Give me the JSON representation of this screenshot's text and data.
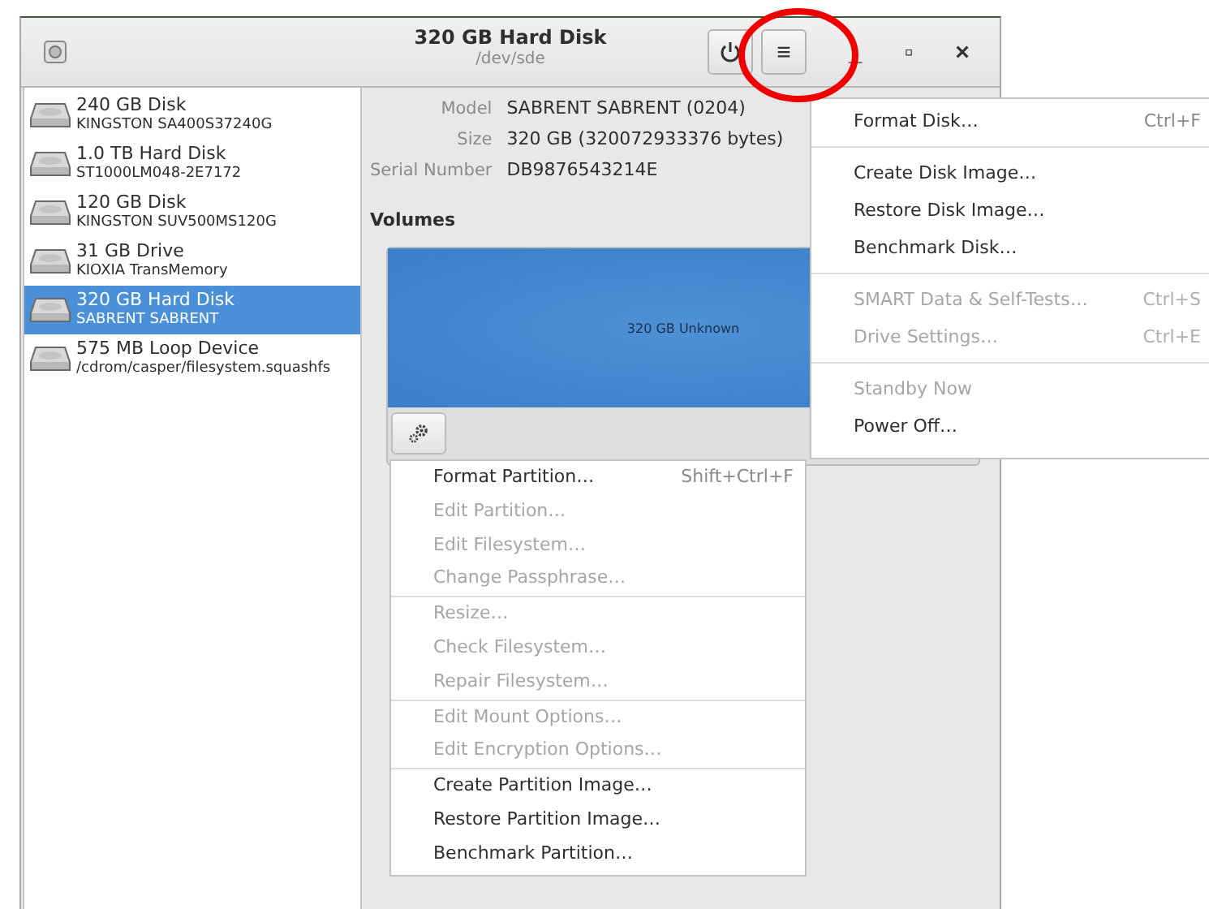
{
  "window": {
    "title": "320 GB Hard Disk",
    "subtitle": "/dev/sde",
    "menu_button_glyph": "≡",
    "minimize_glyph": "_",
    "maximize_glyph": "▫",
    "close_glyph": "×"
  },
  "annotation": {
    "kind": "circle",
    "color": "#ee0000"
  },
  "sidebar": {
    "items": [
      {
        "name": "240 GB Disk",
        "detail": "KINGSTON SA400S37240G",
        "selected": false
      },
      {
        "name": "1.0 TB Hard Disk",
        "detail": "ST1000LM048-2E7172",
        "selected": false
      },
      {
        "name": "120 GB Disk",
        "detail": "KINGSTON SUV500MS120G",
        "selected": false
      },
      {
        "name": "31 GB Drive",
        "detail": "KIOXIA TransMemory",
        "selected": false
      },
      {
        "name": "320 GB Hard Disk",
        "detail": "SABRENT SABRENT",
        "selected": true
      },
      {
        "name": "575 MB Loop Device",
        "detail": "/cdrom/casper/filesystem.squashfs",
        "selected": false
      }
    ]
  },
  "details": [
    {
      "label": "Model",
      "value": "SABRENT SABRENT (0204)"
    },
    {
      "label": "Size",
      "value": "320 GB (320072933376 bytes)"
    },
    {
      "label": "Serial Number",
      "value": "DB9876543214E"
    }
  ],
  "volumes": {
    "heading": "Volumes",
    "segment_label": "320 GB Unknown"
  },
  "disk_menu": {
    "sections": [
      {
        "items": [
          {
            "label": "Format Disk…",
            "shortcut": "Ctrl+F",
            "disabled": false
          }
        ]
      },
      {
        "items": [
          {
            "label": "Create Disk Image…",
            "disabled": false
          },
          {
            "label": "Restore Disk Image…",
            "disabled": false
          },
          {
            "label": "Benchmark Disk…",
            "disabled": false
          }
        ]
      },
      {
        "items": [
          {
            "label": "SMART Data & Self-Tests…",
            "shortcut": "Ctrl+S",
            "disabled": true
          },
          {
            "label": "Drive Settings…",
            "shortcut": "Ctrl+E",
            "disabled": true
          }
        ]
      },
      {
        "items": [
          {
            "label": "Standby Now",
            "disabled": true
          },
          {
            "label": "Power Off…",
            "disabled": false
          }
        ]
      }
    ]
  },
  "partition_menu": {
    "sections": [
      {
        "items": [
          {
            "label": "Format Partition…",
            "shortcut": "Shift+Ctrl+F",
            "disabled": false
          },
          {
            "label": "Edit Partition…",
            "disabled": true
          },
          {
            "label": "Edit Filesystem…",
            "disabled": true
          },
          {
            "label": "Change Passphrase…",
            "disabled": true
          }
        ]
      },
      {
        "items": [
          {
            "label": "Resize…",
            "disabled": true
          },
          {
            "label": "Check Filesystem…",
            "disabled": true
          },
          {
            "label": "Repair Filesystem…",
            "disabled": true
          }
        ]
      },
      {
        "items": [
          {
            "label": "Edit Mount Options…",
            "disabled": true
          },
          {
            "label": "Edit Encryption Options…",
            "disabled": true
          }
        ]
      },
      {
        "items": [
          {
            "label": "Create Partition Image…",
            "disabled": false
          },
          {
            "label": "Restore Partition Image…",
            "disabled": false
          },
          {
            "label": "Benchmark Partition…",
            "disabled": false
          }
        ]
      }
    ]
  }
}
